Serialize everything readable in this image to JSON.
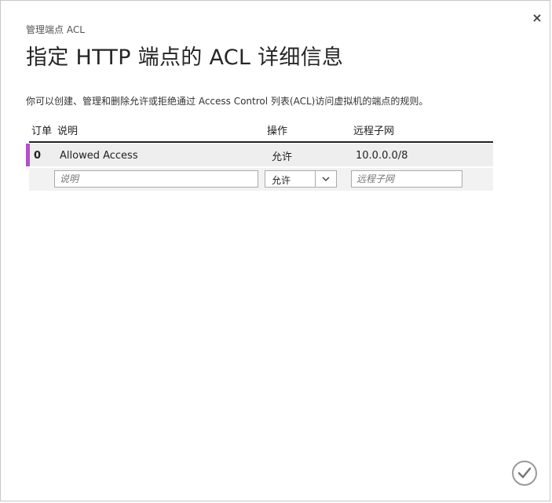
{
  "dialog": {
    "close_glyph": "×",
    "subtitle": "管理端点 ACL",
    "title": "指定 HTTP 端点的 ACL 详细信息",
    "description": "你可以创建、管理和删除允许或拒绝通过 Access Control 列表(ACL)访问虚拟机的端点的规则。"
  },
  "table": {
    "headers": {
      "order": "订单",
      "description": "说明",
      "action": "操作",
      "remote_subnet": "远程子网"
    },
    "rows": [
      {
        "order": "0",
        "description": "Allowed Access",
        "action": "允许",
        "remote_subnet": "10.0.0.0/8"
      }
    ],
    "new_row": {
      "description_placeholder": "说明",
      "action_selected": "允许",
      "remote_subnet_placeholder": "远程子网"
    }
  },
  "colors": {
    "row_accent": "#b44ecb"
  },
  "icons": {
    "close": "close-icon",
    "dropdown": "chevron-down-icon",
    "confirm": "checkmark-icon"
  }
}
